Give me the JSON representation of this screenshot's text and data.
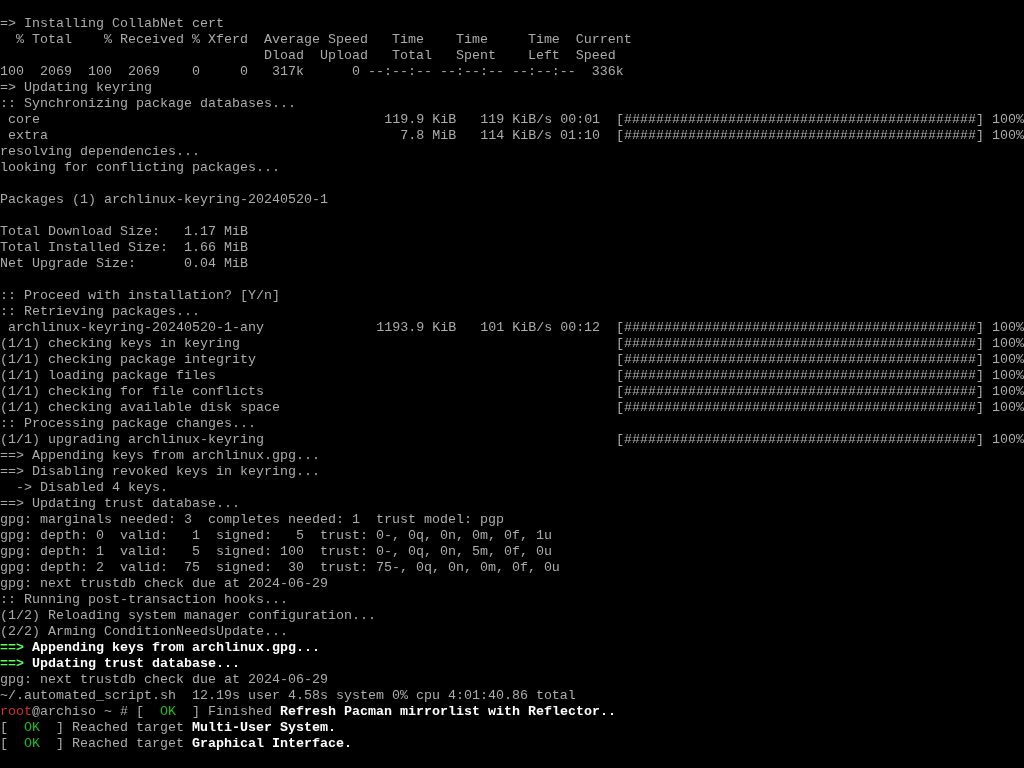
{
  "terminal": {
    "lines": [
      {
        "kind": "text",
        "segments": [
          {
            "text": "=> Installing CollabNet cert",
            "color": "#aaaaaa"
          }
        ]
      },
      {
        "kind": "text",
        "segments": [
          {
            "text": "  % Total    % Received % Xferd  Average Speed   Time    Time     Time  Current",
            "color": "#aaaaaa"
          }
        ]
      },
      {
        "kind": "text",
        "segments": [
          {
            "text": "                                 Dload  Upload   Total   Spent    Left  Speed",
            "color": "#aaaaaa"
          }
        ]
      },
      {
        "kind": "text",
        "segments": [
          {
            "text": "100  2069  100  2069    0     0   317k      0 --:--:-- --:--:-- --:--:--  336k",
            "color": "#aaaaaa"
          }
        ]
      },
      {
        "kind": "text",
        "segments": [
          {
            "text": "=> Updating keyring",
            "color": "#aaaaaa"
          }
        ]
      },
      {
        "kind": "text",
        "segments": [
          {
            "text": ":: Synchronizing package databases...",
            "color": "#aaaaaa"
          }
        ]
      },
      {
        "kind": "progress",
        "label": " core",
        "stats": "119.9 KiB   119 KiB/s 00:01",
        "bar": "[############################################]",
        "percent": "100%"
      },
      {
        "kind": "progress",
        "label": " extra",
        "stats": "7.8 MiB   114 KiB/s 01:10",
        "bar": "[############################################]",
        "percent": "100%"
      },
      {
        "kind": "text",
        "segments": [
          {
            "text": "resolving dependencies...",
            "color": "#aaaaaa"
          }
        ]
      },
      {
        "kind": "text",
        "segments": [
          {
            "text": "looking for conflicting packages...",
            "color": "#aaaaaa"
          }
        ]
      },
      {
        "kind": "blank"
      },
      {
        "kind": "text",
        "segments": [
          {
            "text": "Packages (1) archlinux-keyring-20240520-1",
            "color": "#aaaaaa"
          }
        ]
      },
      {
        "kind": "blank"
      },
      {
        "kind": "text",
        "segments": [
          {
            "text": "Total Download Size:   1.17 MiB",
            "color": "#aaaaaa"
          }
        ]
      },
      {
        "kind": "text",
        "segments": [
          {
            "text": "Total Installed Size:  1.66 MiB",
            "color": "#aaaaaa"
          }
        ]
      },
      {
        "kind": "text",
        "segments": [
          {
            "text": "Net Upgrade Size:      0.04 MiB",
            "color": "#aaaaaa"
          }
        ]
      },
      {
        "kind": "blank"
      },
      {
        "kind": "text",
        "segments": [
          {
            "text": ":: Proceed with installation? [Y/n]",
            "color": "#aaaaaa"
          }
        ]
      },
      {
        "kind": "text",
        "segments": [
          {
            "text": ":: Retrieving packages...",
            "color": "#aaaaaa"
          }
        ]
      },
      {
        "kind": "progress",
        "label": " archlinux-keyring-20240520-1-any",
        "stats": "1193.9 KiB   101 KiB/s 00:12",
        "bar": "[############################################]",
        "percent": "100%"
      },
      {
        "kind": "progress",
        "label": "(1/1) checking keys in keyring",
        "bar": "[############################################]",
        "percent": "100%"
      },
      {
        "kind": "progress",
        "label": "(1/1) checking package integrity",
        "bar": "[############################################]",
        "percent": "100%"
      },
      {
        "kind": "progress",
        "label": "(1/1) loading package files",
        "bar": "[############################################]",
        "percent": "100%"
      },
      {
        "kind": "progress",
        "label": "(1/1) checking for file conflicts",
        "bar": "[############################################]",
        "percent": "100%"
      },
      {
        "kind": "progress",
        "label": "(1/1) checking available disk space",
        "bar": "[############################################]",
        "percent": "100%"
      },
      {
        "kind": "text",
        "segments": [
          {
            "text": ":: Processing package changes...",
            "color": "#aaaaaa"
          }
        ]
      },
      {
        "kind": "progress",
        "label": "(1/1) upgrading archlinux-keyring",
        "bar": "[############################################]",
        "percent": "100%"
      },
      {
        "kind": "text",
        "segments": [
          {
            "text": "==> Appending keys from archlinux.gpg...",
            "color": "#aaaaaa"
          }
        ]
      },
      {
        "kind": "text",
        "segments": [
          {
            "text": "==> Disabling revoked keys in keyring...",
            "color": "#aaaaaa"
          }
        ]
      },
      {
        "kind": "text",
        "segments": [
          {
            "text": "  -> Disabled 4 keys.",
            "color": "#aaaaaa"
          }
        ]
      },
      {
        "kind": "text",
        "segments": [
          {
            "text": "==> Updating trust database...",
            "color": "#aaaaaa"
          }
        ]
      },
      {
        "kind": "text",
        "segments": [
          {
            "text": "gpg: marginals needed: 3  completes needed: 1  trust model: pgp",
            "color": "#aaaaaa"
          }
        ]
      },
      {
        "kind": "text",
        "segments": [
          {
            "text": "gpg: depth: 0  valid:   1  signed:   5  trust: 0-, 0q, 0n, 0m, 0f, 1u",
            "color": "#aaaaaa"
          }
        ]
      },
      {
        "kind": "text",
        "segments": [
          {
            "text": "gpg: depth: 1  valid:   5  signed: 100  trust: 0-, 0q, 0n, 5m, 0f, 0u",
            "color": "#aaaaaa"
          }
        ]
      },
      {
        "kind": "text",
        "segments": [
          {
            "text": "gpg: depth: 2  valid:  75  signed:  30  trust: 75-, 0q, 0n, 0m, 0f, 0u",
            "color": "#aaaaaa"
          }
        ]
      },
      {
        "kind": "text",
        "segments": [
          {
            "text": "gpg: next trustdb check due at 2024-06-29",
            "color": "#aaaaaa"
          }
        ]
      },
      {
        "kind": "text",
        "segments": [
          {
            "text": ":: Running post-transaction hooks...",
            "color": "#aaaaaa"
          }
        ]
      },
      {
        "kind": "text",
        "segments": [
          {
            "text": "(1/2) Reloading system manager configuration...",
            "color": "#aaaaaa"
          }
        ]
      },
      {
        "kind": "text",
        "segments": [
          {
            "text": "(2/2) Arming ConditionNeedsUpdate...",
            "color": "#aaaaaa"
          }
        ]
      },
      {
        "kind": "text",
        "segments": [
          {
            "text": "==>",
            "color": "#55ff55",
            "bold": true
          },
          {
            "text": " Appending keys from archlinux.gpg...",
            "color": "#ffffff",
            "bold": true
          }
        ]
      },
      {
        "kind": "text",
        "segments": [
          {
            "text": "==>",
            "color": "#55ff55",
            "bold": true
          },
          {
            "text": " Updating trust database...",
            "color": "#ffffff",
            "bold": true
          }
        ]
      },
      {
        "kind": "text",
        "segments": [
          {
            "text": "gpg: next trustdb check due at 2024-06-29",
            "color": "#aaaaaa"
          }
        ]
      },
      {
        "kind": "text",
        "segments": [
          {
            "text": "~/.automated_script.sh  12.19s user 4.58s system 0% cpu 4:01:40.86 total",
            "color": "#aaaaaa"
          }
        ]
      },
      {
        "kind": "text",
        "segments": [
          {
            "text": "root",
            "color": "#d03030"
          },
          {
            "text": "@archiso ~ # [  ",
            "color": "#aaaaaa"
          },
          {
            "text": "OK",
            "color": "#22bb22"
          },
          {
            "text": "  ] Finished ",
            "color": "#aaaaaa"
          },
          {
            "text": "Refresh Pacman mirrorlist with Reflector..",
            "color": "#ffffff",
            "bold": true
          }
        ]
      },
      {
        "kind": "text",
        "segments": [
          {
            "text": "[  ",
            "color": "#aaaaaa"
          },
          {
            "text": "OK",
            "color": "#22bb22"
          },
          {
            "text": "  ] Reached target ",
            "color": "#aaaaaa"
          },
          {
            "text": "Multi-User System.",
            "color": "#ffffff",
            "bold": true
          }
        ]
      },
      {
        "kind": "text",
        "segments": [
          {
            "text": "[  ",
            "color": "#aaaaaa"
          },
          {
            "text": "OK",
            "color": "#22bb22"
          },
          {
            "text": "  ] Reached target ",
            "color": "#aaaaaa"
          },
          {
            "text": "Graphical Interface.",
            "color": "#ffffff",
            "bold": true
          }
        ]
      }
    ]
  }
}
